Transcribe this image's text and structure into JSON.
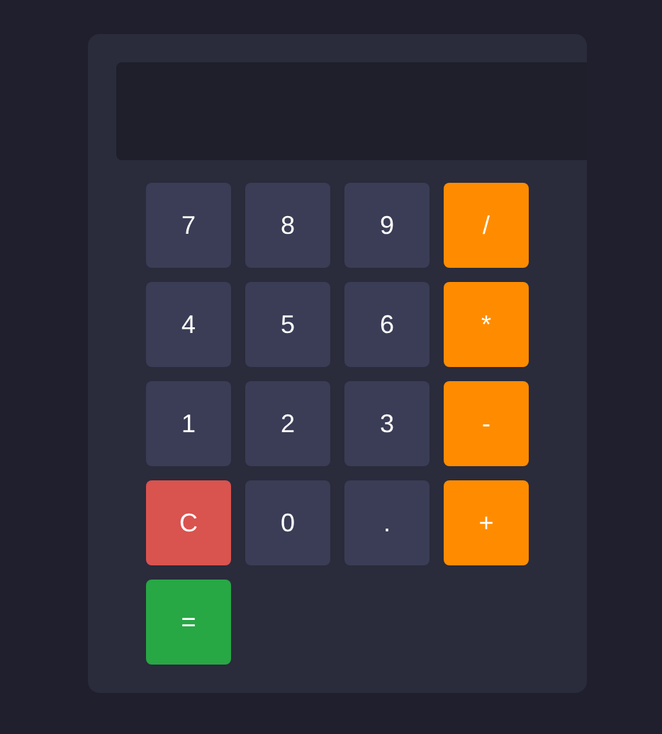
{
  "keys": [
    {
      "label": "7",
      "kind": "number"
    },
    {
      "label": "8",
      "kind": "number"
    },
    {
      "label": "9",
      "kind": "number"
    },
    {
      "label": "/",
      "kind": "operator"
    },
    {
      "label": "4",
      "kind": "number"
    },
    {
      "label": "5",
      "kind": "number"
    },
    {
      "label": "6",
      "kind": "number"
    },
    {
      "label": "*",
      "kind": "operator"
    },
    {
      "label": "1",
      "kind": "number"
    },
    {
      "label": "2",
      "kind": "number"
    },
    {
      "label": "3",
      "kind": "number"
    },
    {
      "label": "-",
      "kind": "operator"
    },
    {
      "label": "C",
      "kind": "clear"
    },
    {
      "label": "0",
      "kind": "number"
    },
    {
      "label": ".",
      "kind": "number"
    },
    {
      "label": "+",
      "kind": "operator"
    },
    {
      "label": "=",
      "kind": "equals"
    }
  ]
}
